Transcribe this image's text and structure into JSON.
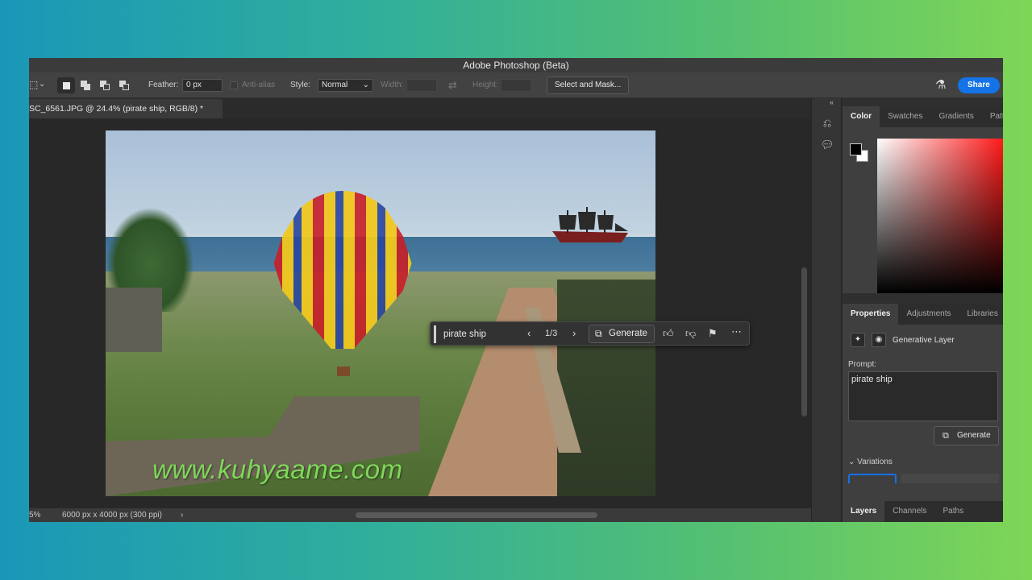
{
  "window": {
    "title": "Adobe Photoshop (Beta)"
  },
  "options_bar": {
    "feather_label": "Feather:",
    "feather_value": "0 px",
    "antialias_label": "Anti-alias",
    "style_label": "Style:",
    "style_value": "Normal",
    "width_label": "Width:",
    "height_label": "Height:",
    "select_mask_label": "Select and Mask...",
    "share_label": "Share"
  },
  "document": {
    "tab_title": "SC_6561.JPG @ 24.4% (pirate ship, RGB/8) *",
    "zoom": "5%",
    "dimensions": "6000 px x 4000 px (300 ppi)"
  },
  "context_bar": {
    "prompt": "pirate ship",
    "counter": "1/3",
    "generate_label": "Generate"
  },
  "watermark": "www.kuhyaame.com",
  "panels": {
    "color_tabs": [
      "Color",
      "Swatches",
      "Gradients",
      "Patt"
    ],
    "props_tabs": [
      "Properties",
      "Adjustments",
      "Libraries"
    ],
    "layer_type": "Generative Layer",
    "prompt_label": "Prompt:",
    "prompt_value": "pirate ship",
    "generate_label": "Generate",
    "variations_label": "Variations",
    "layers_tabs": [
      "Layers",
      "Channels",
      "Paths"
    ]
  },
  "colors": {
    "accent": "#1473e6",
    "foreground": "#000000",
    "background": "#ffffff"
  }
}
